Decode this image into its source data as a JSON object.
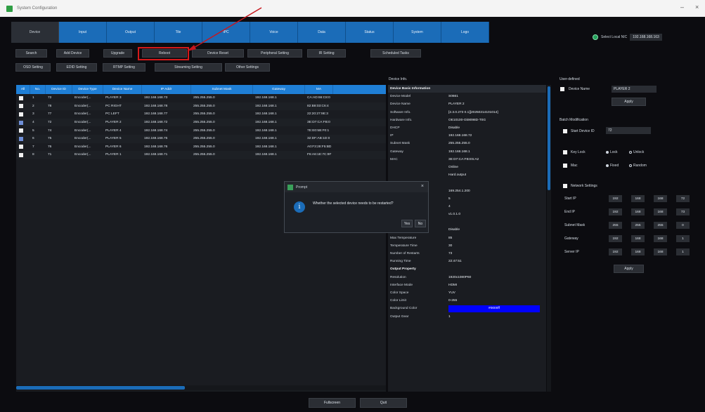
{
  "window": {
    "title": "System Configuration"
  },
  "main_tabs": [
    "Device",
    "Input",
    "Output",
    "Tile",
    "IPC",
    "Voice",
    "Data",
    "Status",
    "System",
    "Logo"
  ],
  "nic": {
    "label": "Select Local NIC",
    "ip": "192.168.168.163"
  },
  "toolbar_row1": [
    "Search",
    "Add Device",
    "Upgrade",
    "Reboot",
    "Device Reset",
    "Peripheral Setting",
    "IR Setting",
    "Scheduled Tasks"
  ],
  "toolbar_row2": [
    "OSD Setting",
    "EDID Setting",
    "RTMP Setting",
    "Streaming Setting",
    "Other Settings"
  ],
  "table": {
    "headers": [
      "All",
      "No.",
      "Device ID",
      "Device Type",
      "Device Name",
      "IP Addr",
      "Subnet Mask",
      "Gateway",
      "MA"
    ],
    "rows": [
      {
        "checked": false,
        "no": "1",
        "id": "72",
        "type": "Encoder(...",
        "name": "PLAYER 3",
        "ip": "192.168.168.73",
        "mask": "255.255.255.0",
        "gw": "192.168.168.1",
        "mac": "CA:AD:66:C8:0"
      },
      {
        "checked": false,
        "no": "2",
        "id": "78",
        "type": "Encoder(...",
        "name": "PC RIGHT",
        "ip": "192.168.168.78",
        "mask": "255.255.255.0",
        "gw": "192.168.168.1",
        "mac": "82:B8:03:C6:4"
      },
      {
        "checked": false,
        "no": "3",
        "id": "77",
        "type": "Encoder(...",
        "name": "PC LEFT",
        "ip": "192.168.168.77",
        "mask": "255.255.255.0",
        "gw": "192.168.168.1",
        "mac": "22:20:27:9E:3"
      },
      {
        "checked": true,
        "no": "4",
        "id": "72",
        "type": "Encoder(...",
        "name": "PLAYER 2",
        "ip": "192.168.168.72",
        "mask": "255.255.255.0",
        "gw": "192.168.168.1",
        "mac": "3E:D7:CA:FB:0"
      },
      {
        "checked": false,
        "no": "5",
        "id": "74",
        "type": "Encoder(...",
        "name": "PLAYER 4",
        "ip": "192.168.168.74",
        "mask": "255.255.255.0",
        "gw": "192.168.168.1",
        "mac": "7E:E0:5B:F0:1"
      },
      {
        "checked": true,
        "no": "6",
        "id": "75",
        "type": "Encoder(...",
        "name": "PLAYER 5",
        "ip": "192.168.168.75",
        "mask": "255.255.255.0",
        "gw": "192.168.168.1",
        "mac": "32:DF:AB:1D:0"
      },
      {
        "checked": false,
        "no": "7",
        "id": "76",
        "type": "Encoder(...",
        "name": "PLAYER 6",
        "ip": "192.168.168.76",
        "mask": "255.255.255.0",
        "gw": "192.168.168.1",
        "mac": "A0:F3:28:F5:BD"
      },
      {
        "checked": false,
        "no": "8",
        "id": "71",
        "type": "Encoder(...",
        "name": "PLAYER 1",
        "ip": "192.168.168.71",
        "mask": "255.255.255.0",
        "gw": "192.168.168.1",
        "mac": "F6:A6:1E:7C:9F"
      }
    ]
  },
  "device_info": {
    "title": "Device Info.",
    "basic_header": "Device Basic Information",
    "rows": [
      {
        "k": "Device Model",
        "v": "S0661"
      },
      {
        "k": "Device Name",
        "v": "PLAYER 2"
      },
      {
        "k": "Software Info.",
        "v": "[2.3.0.273 0.1][20250214101014]"
      },
      {
        "k": "Hardware Info.",
        "v": "OE10100-Gk9098D-T0G"
      },
      {
        "k": "DHCP",
        "v": "Disable"
      },
      {
        "k": "IP",
        "v": "192.168.168.72"
      },
      {
        "k": "Subnet Mask",
        "v": "255.255.255.0"
      },
      {
        "k": "Gateway",
        "v": "192.168.168.1"
      },
      {
        "k": "MAC",
        "v": "3E:D7:CA:FB:E5:A2"
      },
      {
        "k": "",
        "v": "Online"
      },
      {
        "k": "",
        "v": "Hard.output"
      },
      {
        "k": "",
        "v": ""
      },
      {
        "k": "",
        "v": "169.254.1.200"
      },
      {
        "k": "",
        "v": "5"
      },
      {
        "k": "",
        "v": "4"
      },
      {
        "k": "Ultrasonic Version",
        "v": "v1.0.1.0"
      }
    ],
    "extra_header": "Extra",
    "extra_rows": [
      {
        "k": "Temperature Protection",
        "v": "Disable"
      },
      {
        "k": "Max Temperature",
        "v": "85"
      },
      {
        "k": "Temperature Time",
        "v": "30"
      },
      {
        "k": "Number of Restarts",
        "v": "73"
      },
      {
        "k": "Running Time",
        "v": "22:47:51"
      }
    ],
    "output_header": "Output Property",
    "output_rows": [
      {
        "k": "Resolution",
        "v": "1920x1080P60"
      },
      {
        "k": "Interface Mode",
        "v": "HDMI"
      },
      {
        "k": "Color Space",
        "v": "YUV"
      },
      {
        "k": "Color Limit",
        "v": "0-255"
      },
      {
        "k": "Background Color",
        "v": "#0000ff"
      },
      {
        "k": "Output Gear",
        "v": "1"
      }
    ]
  },
  "right_panel": {
    "user_defined": "User-defined",
    "device_name_label": "Device Name",
    "device_name_value": "PLAYER 2",
    "apply": "Apply",
    "batch_mod": "Batch Modification",
    "start_device_id_label": "Start Device ID",
    "start_device_id_value": "72",
    "key_lock": "Key Lock",
    "lock": "Lock",
    "unlock": "Unlock",
    "mac": "Mac",
    "fixed": "Fixed",
    "random": "Random",
    "network_settings": "Network Settings",
    "net_rows": [
      {
        "label": "Start IP",
        "vals": [
          "192",
          "168",
          "168",
          "72"
        ]
      },
      {
        "label": "End IP",
        "vals": [
          "192",
          "168",
          "168",
          "73"
        ]
      },
      {
        "label": "Subnet Mask",
        "vals": [
          "255",
          "255",
          "255",
          "0"
        ]
      },
      {
        "label": "Gateway",
        "vals": [
          "192",
          "168",
          "168",
          "1"
        ]
      },
      {
        "label": "Server IP",
        "vals": [
          "192",
          "168",
          "168",
          "1"
        ]
      }
    ]
  },
  "dialog": {
    "title": "Prompt",
    "message": "Whether the selected device needs to be restarted?",
    "yes": "Yes",
    "no": "No"
  },
  "bottom": {
    "fullscreen": "Fullscreen",
    "quit": "Quit"
  }
}
